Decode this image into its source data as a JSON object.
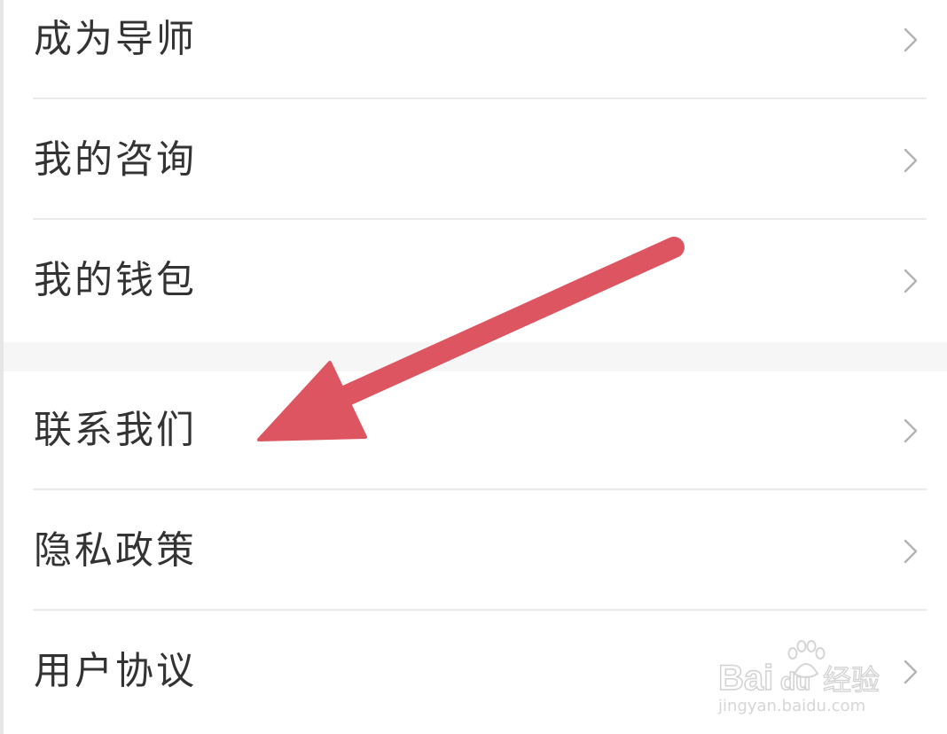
{
  "menu": {
    "group_1": [
      {
        "label": "成为导师"
      },
      {
        "label": "我的咨询"
      },
      {
        "label": "我的钱包"
      }
    ],
    "group_2": [
      {
        "label": "联系我们"
      },
      {
        "label": "隐私政策"
      },
      {
        "label": "用户协议"
      }
    ]
  },
  "chevron_icon": "chevron-right-icon",
  "annotation": {
    "color": "#dd5561",
    "points_to": "联系我们"
  },
  "watermark": {
    "brand": "Baidu经验",
    "url": "jingyan.baidu.com"
  },
  "colors": {
    "text": "#333333",
    "chevron": "#b3b3b3",
    "divider": "#eaeaea",
    "section_gap": "#f6f6f6"
  }
}
